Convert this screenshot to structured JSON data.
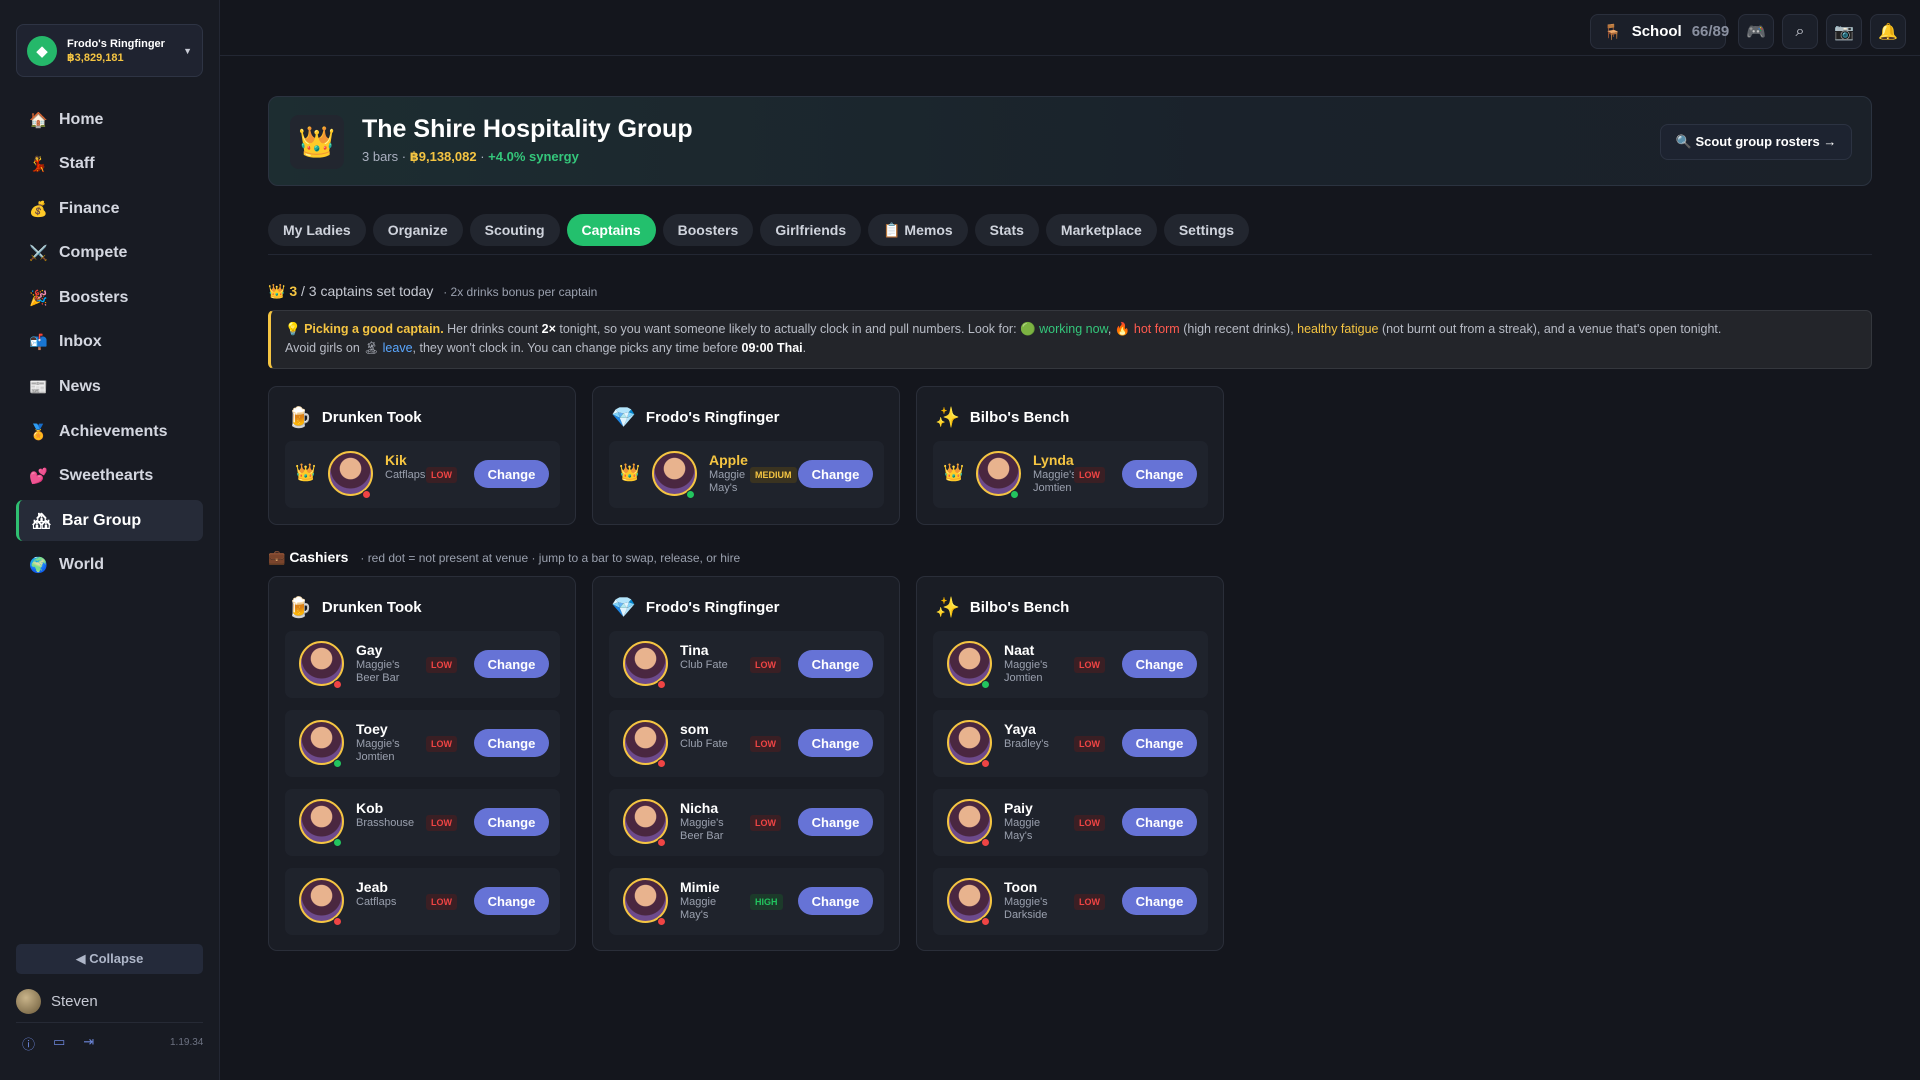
{
  "sidebar": {
    "bar_switch": {
      "name": "Frodo's Ringfinger",
      "money": "฿3,829,181",
      "icon": "gem-icon"
    },
    "items": [
      {
        "label": "Home",
        "icon": "🏠"
      },
      {
        "label": "Staff",
        "icon": "💃"
      },
      {
        "label": "Finance",
        "icon": "💰"
      },
      {
        "label": "Compete",
        "icon": "⚔️"
      },
      {
        "label": "Boosters",
        "icon": "🎉"
      },
      {
        "label": "Inbox",
        "icon": "📬"
      },
      {
        "label": "News",
        "icon": "📰"
      },
      {
        "label": "Achievements",
        "icon": "🏅"
      },
      {
        "label": "Sweethearts",
        "icon": "💕"
      },
      {
        "label": "Bar Group",
        "icon": "🏘"
      },
      {
        "label": "World",
        "icon": "🌍"
      }
    ],
    "active_index": 9,
    "collapse_label": "◀ Collapse",
    "user_name": "Steven",
    "version": "1.19.34"
  },
  "topbar": {
    "school_label": "School",
    "school_progress": "66/89"
  },
  "hero": {
    "title": "The Shire Hospitality Group",
    "bars": "3 bars",
    "money": "฿9,138,082",
    "synergy": "+4.0% synergy",
    "scout_label": "🔍 Scout group rosters →"
  },
  "tabs": [
    "My Ladies",
    "Organize",
    "Scouting",
    "Captains",
    "Boosters",
    "Girlfriends",
    "📋 Memos",
    "Stats",
    "Marketplace",
    "Settings"
  ],
  "active_tab": "Captains",
  "captains": {
    "set": "3",
    "total_text": " / 3 captains set today",
    "bonus": "· 2x drinks bonus per captain"
  },
  "tip": {
    "lead": "Picking a good captain.",
    "t1": " Her drinks count ",
    "mult": "2×",
    "t2": " tonight, so you want someone likely to actually clock in and pull numbers. Look for: 🟢 ",
    "working": "working now",
    "t3": ", 🔥 ",
    "hot": "hot form",
    "t4": " (high recent drinks), ",
    "fatigue": "healthy fatigue",
    "t5": " (not burnt out from a streak), and a venue that's open tonight.",
    "t6": "Avoid girls on 🏝 ",
    "leave": "leave",
    "t7": ", they won't clock in. You can change picks any time before ",
    "time": "09:00 Thai",
    "t8": "."
  },
  "captain_cards": [
    {
      "bar": "Drunken Took",
      "icon": "🍺",
      "girl": {
        "name": "Kik",
        "loc": "Catflaps",
        "rating": "LOW",
        "dot": "red"
      }
    },
    {
      "bar": "Frodo's Ringfinger",
      "icon": "💎",
      "girl": {
        "name": "Apple",
        "loc": "Maggie May's",
        "rating": "MEDIUM",
        "dot": "green"
      }
    },
    {
      "bar": "Bilbo's Bench",
      "icon": "✨",
      "girl": {
        "name": "Lynda",
        "loc": "Maggie's Jomtien",
        "rating": "LOW",
        "dot": "green"
      }
    }
  ],
  "change_label": "Change",
  "cashiers": {
    "title": "💼 Cashiers",
    "note": "· red dot = not present at venue · jump to a bar to swap, release, or hire"
  },
  "cashier_cards": [
    {
      "bar": "Drunken Took",
      "icon": "🍺",
      "girls": [
        {
          "name": "Gay",
          "loc": "Maggie's Beer Bar",
          "rating": "LOW",
          "dot": "red"
        },
        {
          "name": "Toey",
          "loc": "Maggie's Jomtien",
          "rating": "LOW",
          "dot": "green"
        },
        {
          "name": "Kob",
          "loc": "Brasshouse",
          "rating": "LOW",
          "dot": "green"
        },
        {
          "name": "Jeab",
          "loc": "Catflaps",
          "rating": "LOW",
          "dot": "red"
        }
      ]
    },
    {
      "bar": "Frodo's Ringfinger",
      "icon": "💎",
      "girls": [
        {
          "name": "Tina",
          "loc": "Club Fate",
          "rating": "LOW",
          "dot": "red"
        },
        {
          "name": "som",
          "loc": "Club Fate",
          "rating": "LOW",
          "dot": "red"
        },
        {
          "name": "Nicha",
          "loc": "Maggie's Beer Bar",
          "rating": "LOW",
          "dot": "red"
        },
        {
          "name": "Mimie",
          "loc": "Maggie May's",
          "rating": "HIGH",
          "dot": "red"
        }
      ]
    },
    {
      "bar": "Bilbo's Bench",
      "icon": "✨",
      "girls": [
        {
          "name": "Naat",
          "loc": "Maggie's Jomtien",
          "rating": "LOW",
          "dot": "green"
        },
        {
          "name": "Yaya",
          "loc": "Bradley's",
          "rating": "LOW",
          "dot": "red"
        },
        {
          "name": "Paiy",
          "loc": "Maggie May's",
          "rating": "LOW",
          "dot": "red"
        },
        {
          "name": "Toon",
          "loc": "Maggie's Darkside",
          "rating": "LOW",
          "dot": "red"
        }
      ]
    }
  ]
}
